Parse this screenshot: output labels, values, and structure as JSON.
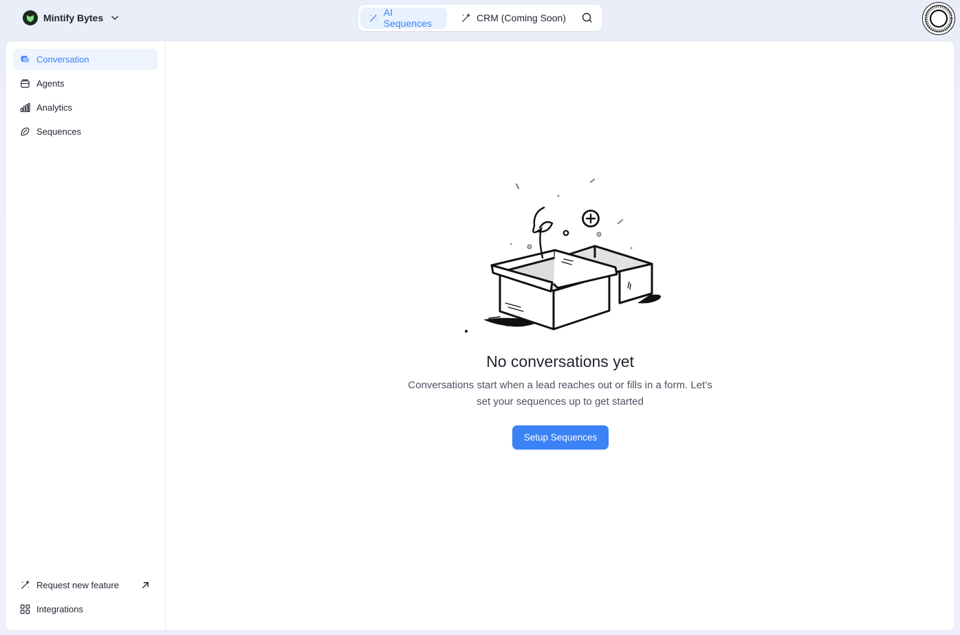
{
  "workspace": {
    "name": "Mintify Bytes",
    "logo_icon": "shield-logo-icon",
    "chevron_icon": "chevron-down-icon"
  },
  "switcher": {
    "tabs": [
      {
        "label": "AI Sequences",
        "icon": "magic-wand-icon",
        "active": true
      },
      {
        "label": "CRM (Coming Soon)",
        "icon": "magic-wand-icon",
        "active": false
      }
    ],
    "search_icon": "search-icon"
  },
  "sidebar": {
    "items": [
      {
        "label": "Conversation",
        "icon": "chat-icon",
        "active": true
      },
      {
        "label": "Agents",
        "icon": "agents-icon",
        "active": false
      },
      {
        "label": "Analytics",
        "icon": "bar-chart-icon",
        "active": false
      },
      {
        "label": "Sequences",
        "icon": "sequences-icon",
        "active": false
      }
    ],
    "footer": [
      {
        "label": "Request new feature",
        "icon": "magic-wand-icon",
        "external_icon": "arrow-up-right-icon"
      },
      {
        "label": "Integrations",
        "icon": "grid-icon"
      }
    ]
  },
  "empty_state": {
    "title": "No conversations yet",
    "description": "Conversations start when a lead reaches out or fills in a form. Let’s set your sequences up to get started",
    "cta_label": "Setup Sequences",
    "illustration": "empty-box-illustration"
  },
  "colors": {
    "accent": "#3b82f6",
    "active_bg": "#eef4fe",
    "logo_green": "#7ee084"
  }
}
